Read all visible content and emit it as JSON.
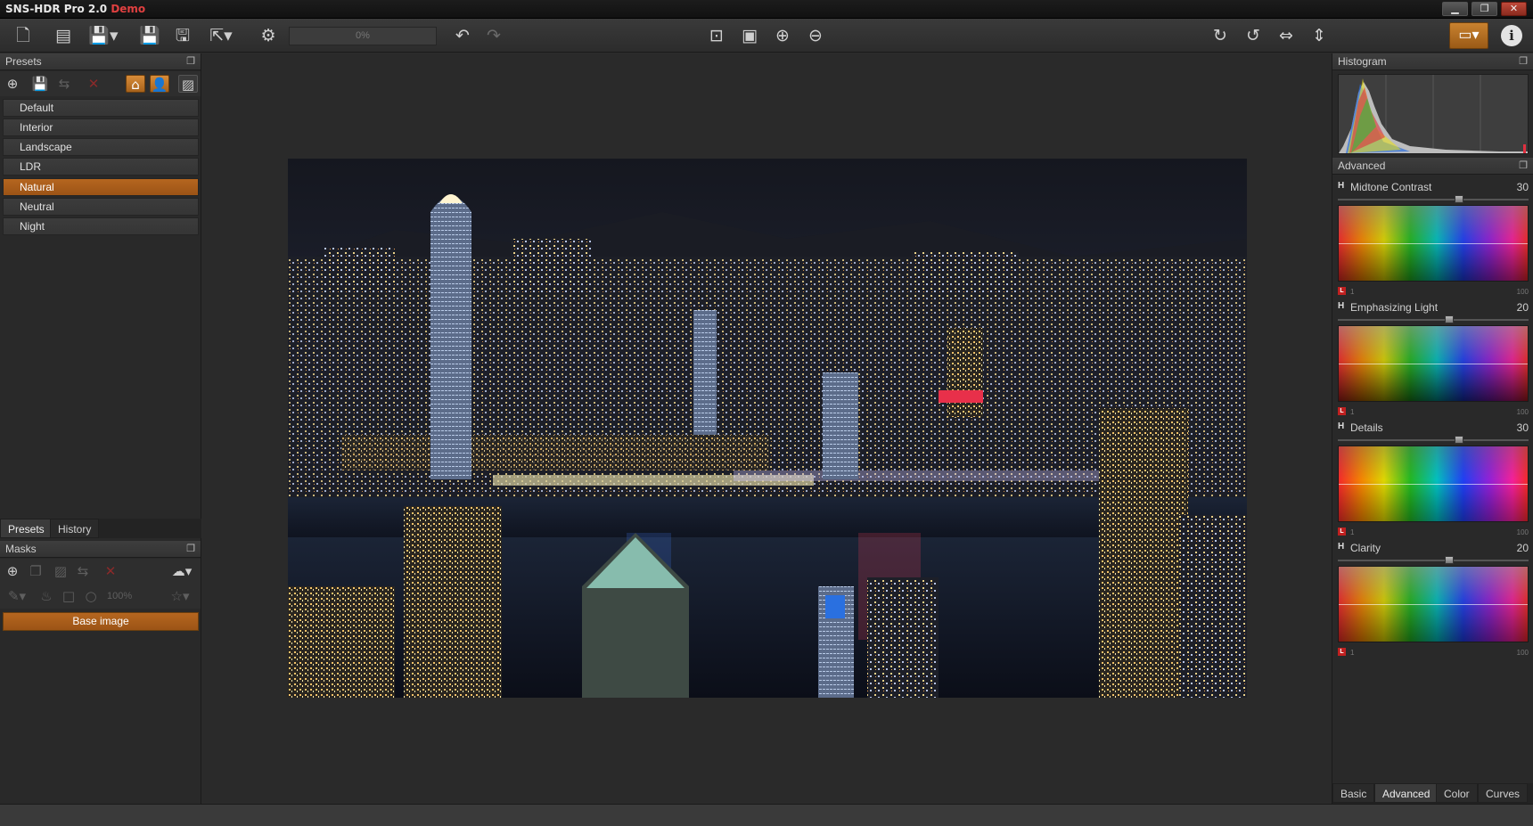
{
  "titlebar": {
    "app_name": "SNS-HDR Pro 2.0 ",
    "edition": "Demo",
    "minimize": "▁",
    "restore": "❐",
    "close": "✕"
  },
  "toolbar": {
    "progress_text": "0%",
    "icons": {
      "new": "🗋",
      "sns": "▤",
      "save_menu": "💾▾",
      "save": "💾",
      "save_as": "🖫",
      "export": "⇱▾",
      "settings": "⚙",
      "undo": "↶",
      "redo": "↷",
      "zoom_actual": "⊡",
      "zoom_fit": "▣",
      "zoom_in": "⊕",
      "zoom_out": "⊖",
      "rotate_cw": "↻",
      "rotate_ccw": "↺",
      "flip_h": "⇔",
      "flip_v": "⇕",
      "display": "▭▾",
      "info": "i"
    }
  },
  "presets_panel": {
    "title": "Presets",
    "items": [
      "Default",
      "Interior",
      "Landscape",
      "LDR",
      "Natural",
      "Neutral",
      "Night"
    ],
    "selected": "Natural",
    "tabs": [
      "Presets",
      "History"
    ]
  },
  "masks_panel": {
    "title": "Masks",
    "zoom": "100%",
    "base_image": "Base image"
  },
  "histogram_panel": {
    "title": "Histogram"
  },
  "advanced_panel": {
    "title": "Advanced",
    "adjustments": [
      {
        "label": "Midtone Contrast",
        "value": "30",
        "position": 0.64
      },
      {
        "label": "Emphasizing Light",
        "value": "20",
        "position": 0.59
      },
      {
        "label": "Details",
        "value": "30",
        "position": 0.64
      },
      {
        "label": "Clarity",
        "value": "20",
        "position": 0.59
      }
    ],
    "curve_min": "1",
    "curve_max": "100",
    "curve_l": "L",
    "h_marker": "H"
  },
  "bottom_tabs": [
    "Basic",
    "Advanced",
    "Color",
    "Curves"
  ],
  "active_bottom_tab": "Advanced"
}
